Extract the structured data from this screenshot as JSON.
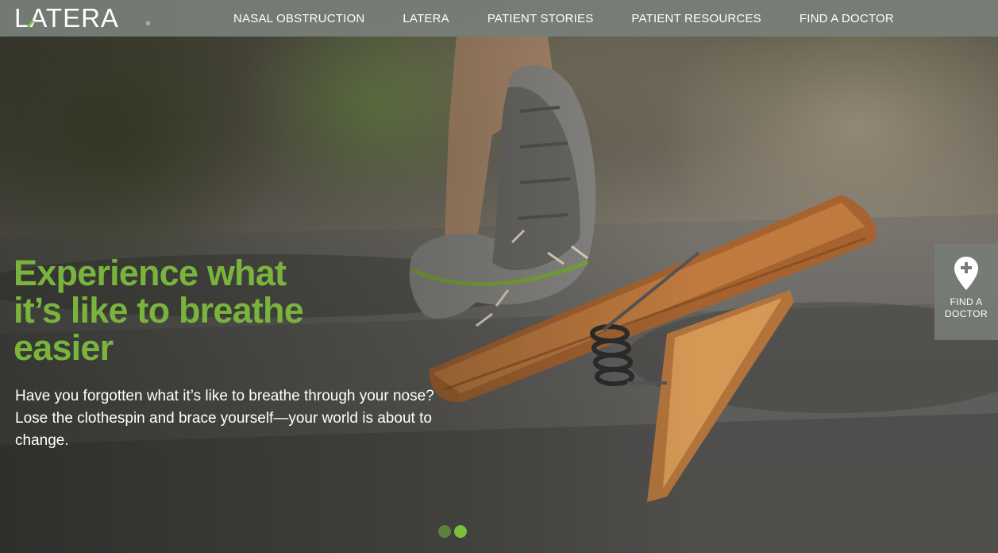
{
  "brand": {
    "logo_text": "LATERA",
    "registered_mark": "®",
    "accent_color": "#79b43c"
  },
  "nav": {
    "items": [
      {
        "label": "NASAL OBSTRUCTION"
      },
      {
        "label": "LATERA"
      },
      {
        "label": "PATIENT STORIES"
      },
      {
        "label": "PATIENT RESOURCES"
      },
      {
        "label": "FIND A DOCTOR"
      }
    ]
  },
  "hero": {
    "headline_line1": "Experience what",
    "headline_line2": "it’s like to breathe",
    "headline_line3": "easier",
    "subtext": "Have you forgotten what it’s like to breathe through your nose? Lose the clothespin and brace yourself—your world is about to change."
  },
  "side_tab": {
    "icon": "map-pin-plus-icon",
    "label_line1": "FIND A",
    "label_line2": "DOCTOR"
  },
  "slider": {
    "slide_count": 2,
    "active_index": 1
  }
}
